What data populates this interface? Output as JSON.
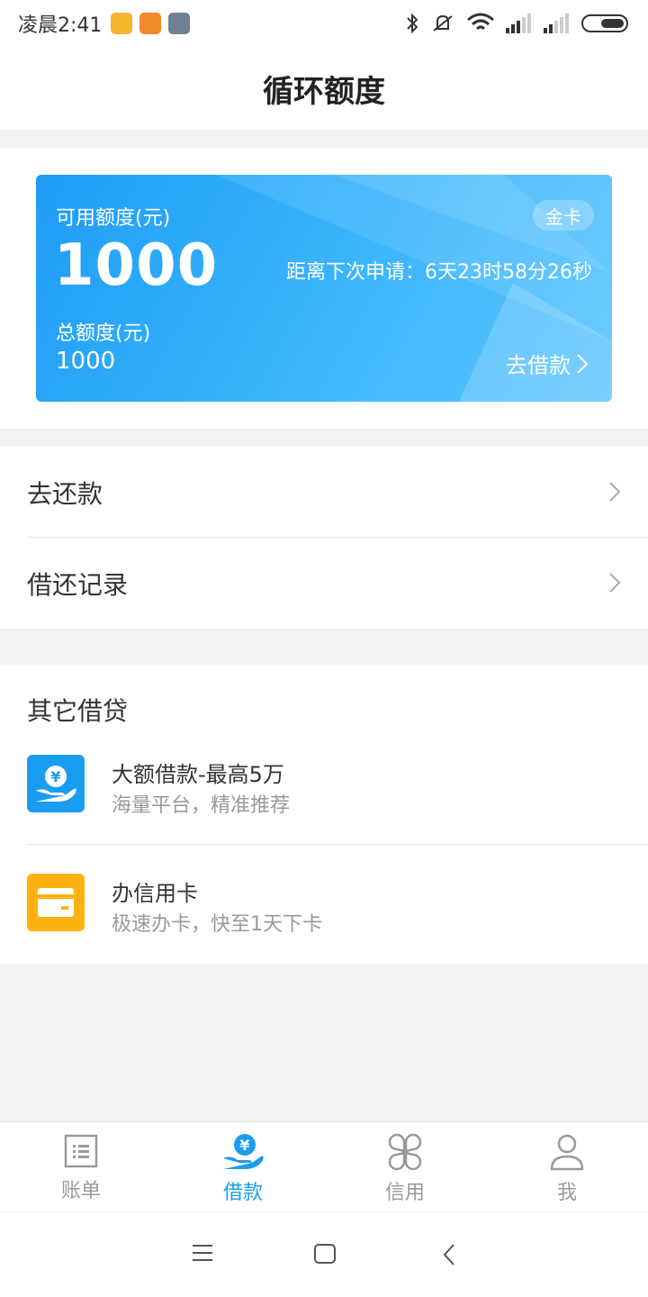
{
  "status_bar": {
    "time": "凌晨2:41",
    "icons": [
      "app-notification-icon",
      "uc-browser-icon",
      "calendar-icon",
      "bluetooth-icon",
      "mute-icon",
      "wifi-icon",
      "signal-icon",
      "signal-icon",
      "battery-icon"
    ]
  },
  "header": {
    "title": "循环额度"
  },
  "card": {
    "available_label": "可用额度(元)",
    "available_amount": "1000",
    "badge": "金卡",
    "countdown": "距离下次申请：6天23时58分26秒",
    "total_label": "总额度(元)",
    "total_amount": "1000",
    "borrow_label": "去借款"
  },
  "menu": {
    "items": [
      {
        "label": "去还款"
      },
      {
        "label": "借还记录"
      }
    ]
  },
  "other_loans": {
    "title": "其它借贷",
    "items": [
      {
        "title": "大额借款-最高5万",
        "subtitle": "海量平台，精准推荐",
        "icon": "hand-yuan-icon",
        "icon_color": "#1a9cf0"
      },
      {
        "title": "办信用卡",
        "subtitle": "极速办卡，快至1天下卡",
        "icon": "credit-card-icon",
        "icon_color": "#fdb30f"
      }
    ]
  },
  "tabbar": {
    "active_color": "#1a9cf0",
    "tabs": [
      {
        "label": "账单",
        "icon": "bill-icon",
        "active": false
      },
      {
        "label": "借款",
        "icon": "loan-icon",
        "active": true
      },
      {
        "label": "信用",
        "icon": "credit-grid-icon",
        "active": false
      },
      {
        "label": "我",
        "icon": "profile-icon",
        "active": false
      }
    ]
  },
  "system_nav": {
    "buttons": [
      "menu-icon",
      "home-icon",
      "back-icon"
    ]
  }
}
